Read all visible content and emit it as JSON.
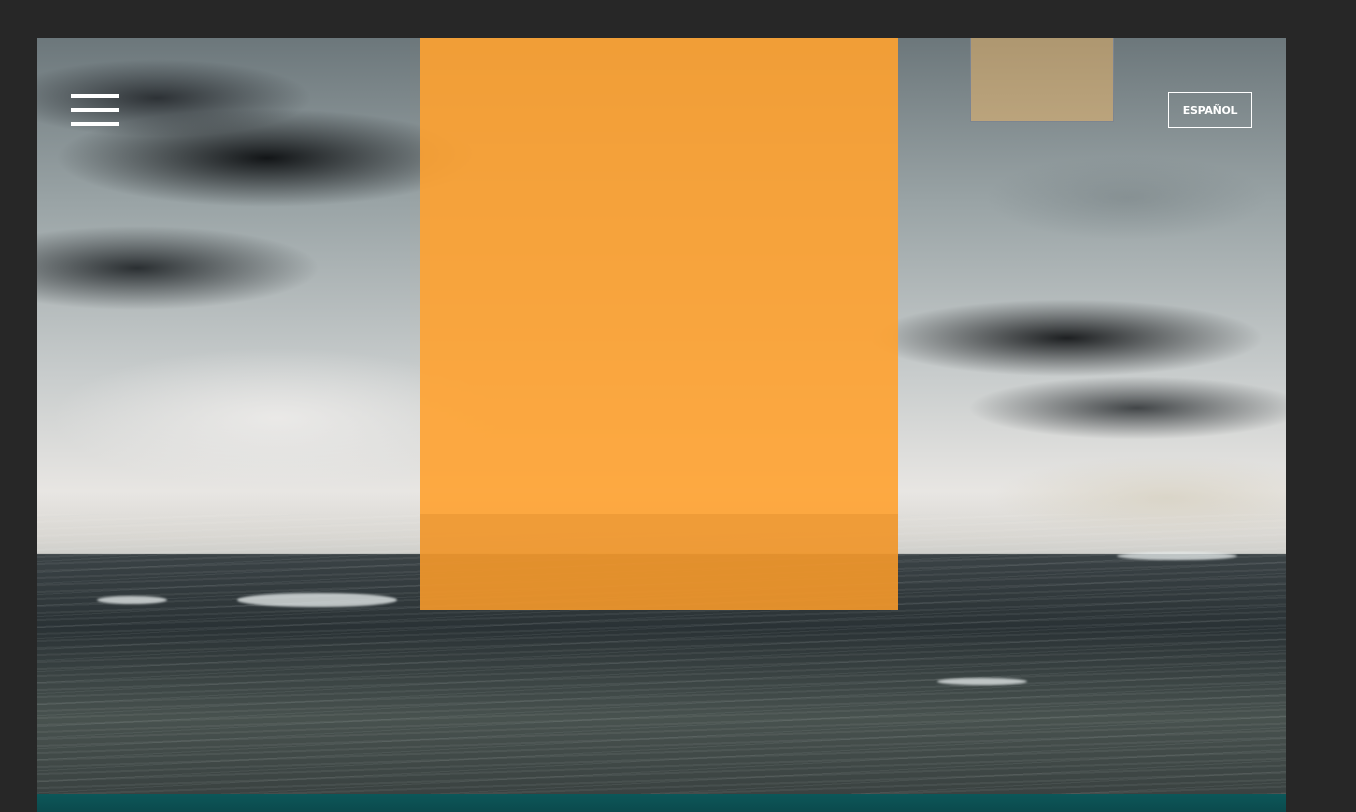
{
  "header": {
    "language_button_label": "ESPAÑOL",
    "menu_icon": "hamburger-menu-icon"
  },
  "hero": {
    "background": "stormy-sea-photo",
    "overlay_color": "#ffa230"
  },
  "footer": {
    "color": "#0b5356"
  }
}
